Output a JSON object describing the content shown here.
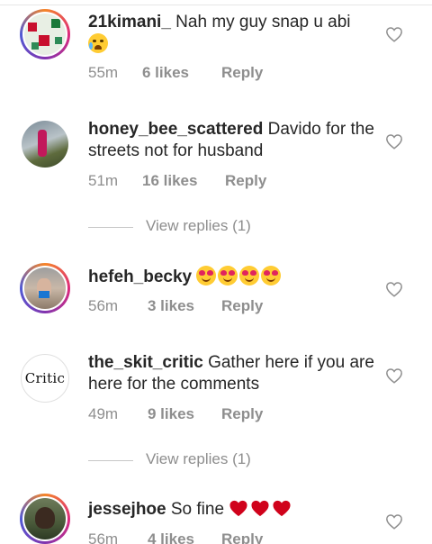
{
  "comments": [
    {
      "username": "21kimani_",
      "text": " Nah my guy snap u abi",
      "emoji_icons": [
        "crying-face-icon"
      ],
      "time": "55m",
      "likes": "6 likes",
      "reply": "Reply",
      "story_ring": true
    },
    {
      "username": "honey_bee_scattered",
      "text": " Davido for the streets not for husband",
      "time": "51m",
      "likes": "16 likes",
      "reply": "Reply",
      "story_ring": false,
      "view_replies": "View replies (1)"
    },
    {
      "username": "hefeh_becky",
      "text": " ",
      "emoji_icons": [
        "heart-eyes-icon",
        "heart-eyes-icon",
        "heart-eyes-icon",
        "heart-eyes-icon"
      ],
      "time": "56m",
      "likes": "3 likes",
      "reply": "Reply",
      "story_ring": true
    },
    {
      "username": "the_skit_critic",
      "text": " Gather here if you are here for the comments",
      "avatar_text": "Critic",
      "time": "49m",
      "likes": "9 likes",
      "reply": "Reply",
      "story_ring": false,
      "view_replies": "View replies (1)"
    },
    {
      "username": "jessejhoe",
      "text": " So fine ",
      "emoji_icons": [
        "red-heart-icon",
        "red-heart-icon",
        "red-heart-icon"
      ],
      "time": "56m",
      "likes": "4 likes",
      "reply": "Reply",
      "story_ring": true
    }
  ],
  "colors": {
    "text": "#262626",
    "meta": "#8e8e8e",
    "divider": "#c7c7c7",
    "heart_red": "#e0245e"
  }
}
